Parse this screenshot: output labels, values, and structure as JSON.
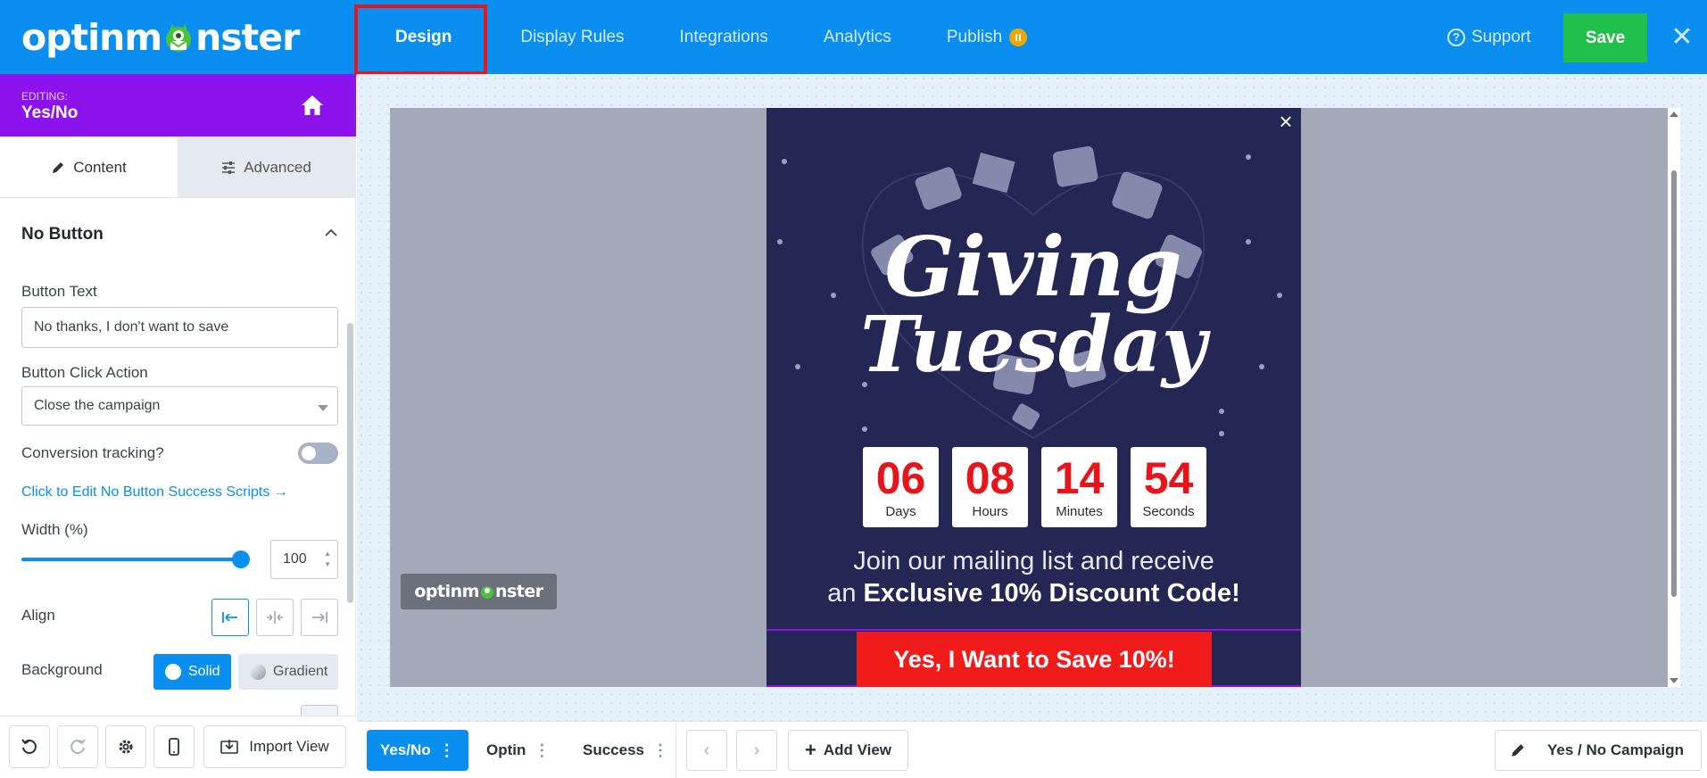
{
  "header": {
    "logo_text_left": "optinm",
    "logo_text_right": "nster",
    "nav": [
      {
        "label": "Design",
        "active": true
      },
      {
        "label": "Display Rules"
      },
      {
        "label": "Integrations"
      },
      {
        "label": "Analytics"
      },
      {
        "label": "Publish"
      }
    ],
    "support_label": "Support",
    "save_label": "Save",
    "close_icon": "close-icon"
  },
  "sidebar": {
    "editing_label": "EDITING:",
    "editing_name": "Yes/No",
    "tabs": [
      {
        "label": "Content",
        "active": true
      },
      {
        "label": "Advanced"
      }
    ],
    "section_title": "No Button",
    "button_text_label": "Button Text",
    "button_text_value": "No thanks, I don't want to save",
    "click_action_label": "Button Click Action",
    "click_action_value": "Close the campaign",
    "conversion_label": "Conversion tracking?",
    "conversion_enabled": false,
    "success_scripts_link": "Click to Edit No Button Success Scripts →",
    "width_label": "Width (%)",
    "width_value": "100",
    "width_fraction": 1.0,
    "align_label": "Align",
    "align_selected": "left",
    "background_label": "Background",
    "bg_solid": "Solid",
    "bg_gradient": "Gradient",
    "bottom": {
      "import_view_label": "Import View"
    }
  },
  "canvas": {
    "om_badge_left": "optinm",
    "om_badge_right": "nster",
    "popup": {
      "countdown": [
        {
          "value": "06",
          "label": "Days"
        },
        {
          "value": "08",
          "label": "Hours"
        },
        {
          "value": "14",
          "label": "Minutes"
        },
        {
          "value": "54",
          "label": "Seconds"
        }
      ],
      "promo_line1": "Join our mailing list and receive",
      "promo_line2_prefix": "an ",
      "promo_line2_bold": "Exclusive 10% Discount Code!",
      "cta_label": "Yes, I Want to Save 10%!",
      "art_title_line1": "Giving",
      "art_title_line2": "Tuesday"
    }
  },
  "bottombar": {
    "views": [
      {
        "label": "Yes/No",
        "active": true
      },
      {
        "label": "Optin"
      },
      {
        "label": "Success"
      }
    ],
    "add_view_label": "Add View",
    "campaign_name": "Yes / No Campaign"
  },
  "colors": {
    "brand_blue": "#0a8ef0",
    "editing_purple": "#8c12ee",
    "save_green": "#21c04a",
    "popup_bg": "#242653",
    "cta_red": "#f11b1b",
    "annotation_red": "#e8141c"
  }
}
